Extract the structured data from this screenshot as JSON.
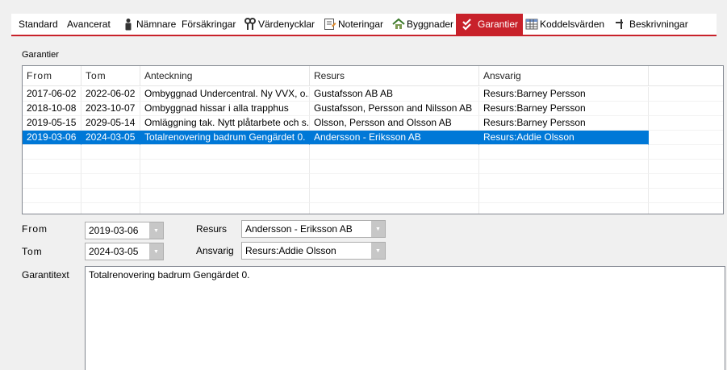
{
  "tabs": [
    {
      "label": "Standard",
      "icon": "none"
    },
    {
      "label": "Avancerat",
      "icon": "none"
    },
    {
      "label": "Nämnare",
      "icon": "person-icon"
    },
    {
      "label": "Försäkringar",
      "icon": "none"
    },
    {
      "label": "Värdenycklar",
      "icon": "keys-icon"
    },
    {
      "label": "Noteringar",
      "icon": "notes-icon"
    },
    {
      "label": "Byggnader",
      "icon": "house-icon"
    },
    {
      "label": "Garantier",
      "icon": "checkmarks-icon",
      "active": true
    },
    {
      "label": "Koddelsvärden",
      "icon": "table-icon"
    },
    {
      "label": "Beskrivningar",
      "icon": "pin-icon"
    }
  ],
  "group_label": "Garantier",
  "grid": {
    "columns": [
      "From",
      "Tom",
      "Anteckning",
      "Resurs",
      "Ansvarig"
    ],
    "rows": [
      [
        "2017-06-02",
        "2022-06-02",
        "Ombyggnad Undercentral. Ny VVX, o...",
        "Gustafsson AB AB",
        "Resurs:Barney Persson"
      ],
      [
        "2018-10-08",
        "2023-10-07",
        "Ombyggnad hissar i alla trapphus",
        "Gustafsson, Persson and Nilsson AB",
        "Resurs:Barney Persson"
      ],
      [
        "2019-05-15",
        "2029-05-14",
        "Omläggning tak. Nytt plåtarbete och s...",
        "Olsson, Persson and Olsson AB",
        "Resurs:Barney Persson"
      ],
      [
        "2019-03-06",
        "2024-03-05",
        "Totalrenovering badrum Gengärdet 0.",
        "Andersson - Eriksson AB",
        "Resurs:Addie Olsson"
      ]
    ],
    "selected_index": 3,
    "empty_rows": 5
  },
  "form": {
    "from_label": "From",
    "from_value": "2019-03-06",
    "tom_label": "Tom",
    "tom_value": "2024-03-05",
    "resurs_label": "Resurs",
    "resurs_value": "Andersson - Eriksson AB",
    "ansvarig_label": "Ansvarig",
    "ansvarig_value": "Resurs:Addie Olsson",
    "garantitext_label": "Garantitext",
    "garantitext_value": "Totalrenovering badrum Gengärdet 0."
  },
  "colors": {
    "accent": "#c8212a",
    "selection": "#0078d7"
  }
}
